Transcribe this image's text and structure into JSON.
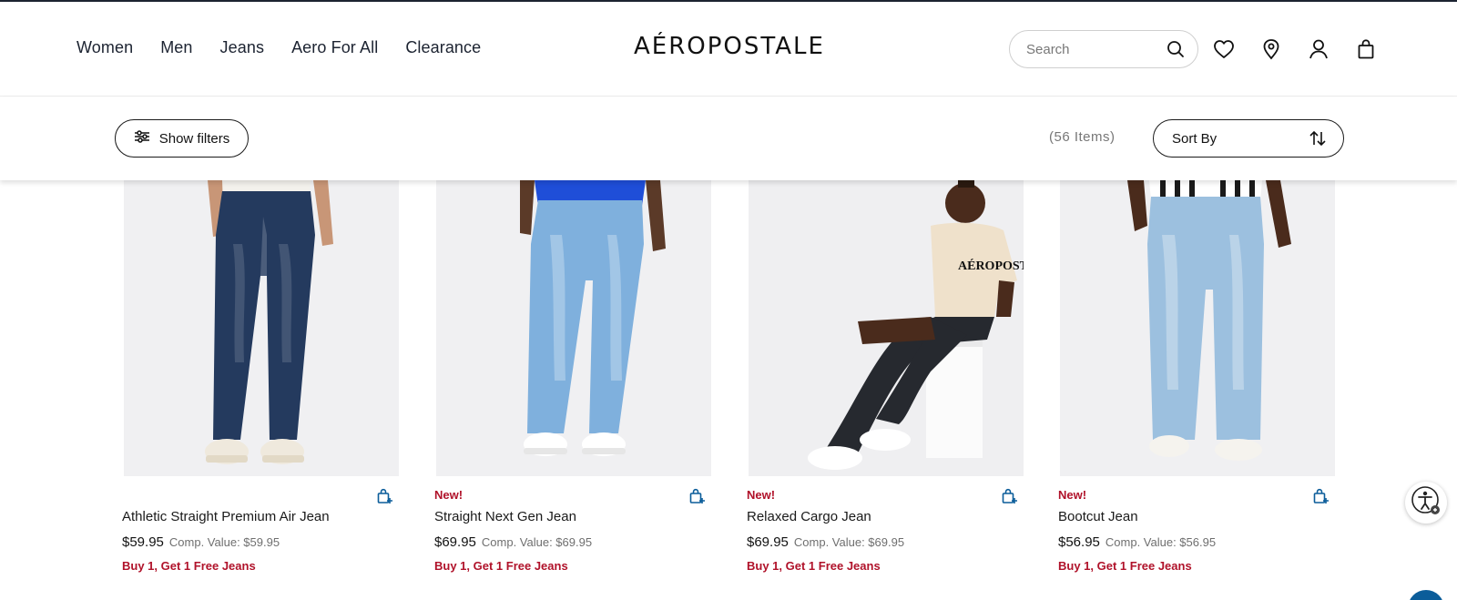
{
  "brand": {
    "logo": "AÉROPOSTALE"
  },
  "nav": {
    "items": [
      "Women",
      "Men",
      "Jeans",
      "Aero For All",
      "Clearance"
    ]
  },
  "search": {
    "placeholder": "Search"
  },
  "header_icons": [
    "heart-icon",
    "location-pin-icon",
    "account-icon",
    "shopping-bag-icon"
  ],
  "toolbar": {
    "filters_label": "Show filters",
    "items_count": "(56 Items)",
    "sort_label": "Sort By"
  },
  "colors": {
    "promo_red": "#b0122a",
    "nav_text": "#1c2331",
    "add_to_bag_blue": "#0b5d9a",
    "photo_bg": "#f0f0f2"
  },
  "products": [
    {
      "name": "Athletic Straight Premium Air Jean",
      "badge": "",
      "price": "$59.95",
      "comp": "Comp. Value: $59.95",
      "promo": "Buy 1, Get 1 Free Jeans",
      "denim": "#243a5e",
      "shirt": "#f3f1ec"
    },
    {
      "name": "Straight Next Gen Jean",
      "badge": "New!",
      "price": "$69.95",
      "comp": "Comp. Value: $69.95",
      "promo": "Buy 1, Get 1 Free Jeans",
      "denim": "#7fb0dd",
      "shirt": "#1f4ed8"
    },
    {
      "name": "Relaxed Cargo Jean",
      "badge": "New!",
      "price": "$69.95",
      "comp": "Comp. Value: $69.95",
      "promo": "Buy 1, Get 1 Free Jeans",
      "denim": "#26292f",
      "shirt": "#efe1cb"
    },
    {
      "name": "Bootcut Jean",
      "badge": "New!",
      "price": "$56.95",
      "comp": "Comp. Value: $56.95",
      "promo": "Buy 1, Get 1 Free Jeans",
      "denim": "#9cc0df",
      "shirt": "#ffffff"
    }
  ]
}
